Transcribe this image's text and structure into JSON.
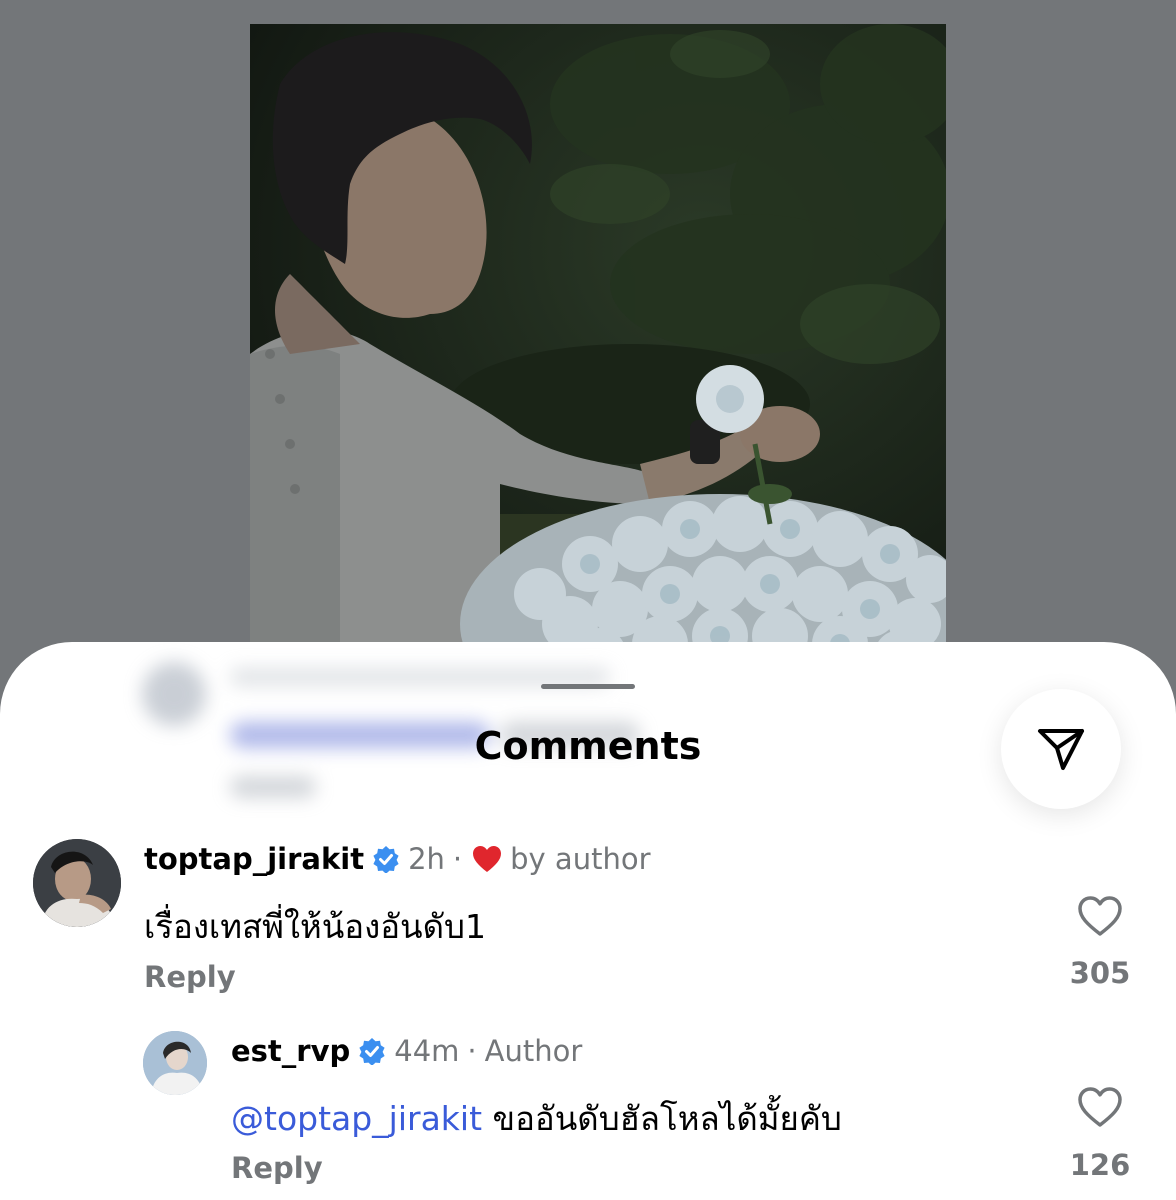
{
  "sheet": {
    "title": "Comments",
    "share_icon": "send-icon"
  },
  "comments": [
    {
      "username": "toptap_jirakit",
      "time": "2h",
      "separator": "·",
      "liked_by_author_label": "by author",
      "text": "เรื่องเทสพี่ให้น้องอันดับ1",
      "reply_label": "Reply",
      "like_count": "305"
    },
    {
      "username": "est_rvp",
      "time": "44m",
      "separator": "·",
      "author_label": "Author",
      "mention": "@toptap_jirakit",
      "text": "ขออันดับฮัลโหลได้มั้ยคับ",
      "reply_label": "Reply",
      "like_count": "126"
    }
  ],
  "colors": {
    "backdrop": "#737679",
    "sheet": "#ffffff",
    "mention": "#3a5bd9",
    "heart": "#e0262d",
    "verified": "#3b8ff0",
    "muted_text": "#737679"
  }
}
